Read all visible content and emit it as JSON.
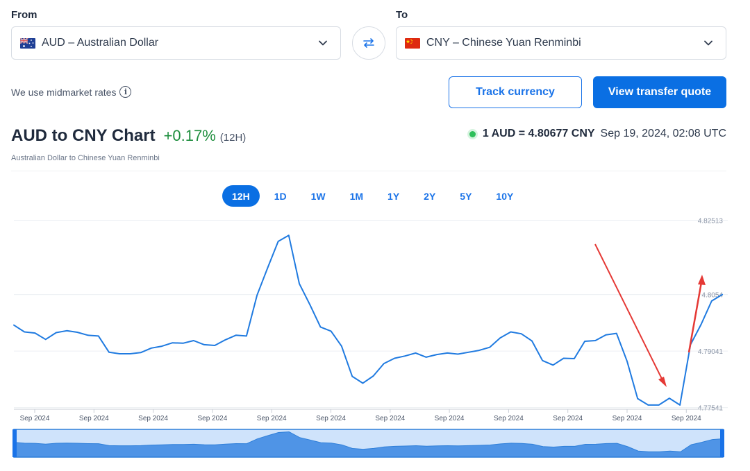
{
  "from": {
    "label": "From",
    "currency": "AUD – Australian Dollar"
  },
  "to": {
    "label": "To",
    "currency": "CNY – Chinese Yuan Renminbi"
  },
  "midmarket_text": "We use midmarket rates",
  "buttons": {
    "track": "Track currency",
    "quote": "View transfer quote"
  },
  "header": {
    "title": "AUD to CNY Chart",
    "change": "+0.17%",
    "period": "(12H)",
    "subtitle": "Australian Dollar to Chinese Yuan Renminbi"
  },
  "rate": {
    "value": "1 AUD = 4.80677 CNY",
    "timestamp": "Sep 19, 2024, 02:08 UTC"
  },
  "periods": [
    "12H",
    "1D",
    "1W",
    "1M",
    "1Y",
    "2Y",
    "5Y",
    "10Y"
  ],
  "active_period": "12H",
  "colors": {
    "accent": "#0a6fe3",
    "line": "#1f7ae0",
    "positive": "#1e8e3e",
    "annotation": "#e53935"
  },
  "chart_data": {
    "type": "line",
    "title": "AUD to CNY Chart",
    "ylim": [
      4.7735,
      4.8265
    ],
    "y_tick_values": [
      4.82513,
      4.80541,
      4.79041,
      4.77541
    ],
    "y_tick_labels": [
      "4.82513",
      "4.8054",
      "4.79041",
      "4.77541"
    ],
    "x_tick_labels": [
      "Sep 2024",
      "Sep 2024",
      "Sep 2024",
      "Sep 2024",
      "Sep 2024",
      "Sep 2024",
      "Sep 2024",
      "Sep 2024",
      "Sep 2024",
      "Sep 2024",
      "Sep 2024",
      "Sep 2024"
    ],
    "grid": true,
    "series": [
      {
        "values": [
          4.7973,
          4.7955,
          4.7952,
          4.7935,
          4.7953,
          4.7958,
          4.7954,
          4.7946,
          4.7944,
          4.7901,
          4.7897,
          4.7897,
          4.79,
          4.7912,
          4.7917,
          4.7926,
          4.7925,
          4.7932,
          4.7921,
          4.7919,
          4.7934,
          4.7946,
          4.7944,
          4.8052,
          4.8125,
          4.8195,
          4.8211,
          4.8083,
          4.8027,
          4.7968,
          4.7957,
          4.7917,
          4.7837,
          4.7819,
          4.7838,
          4.7871,
          4.7885,
          4.7891,
          4.7899,
          4.7888,
          4.7895,
          4.7899,
          4.7896,
          4.7901,
          4.7906,
          4.7914,
          4.7939,
          4.7955,
          4.795,
          4.7931,
          4.7879,
          4.7867,
          4.7885,
          4.7884,
          4.793,
          4.7932,
          4.7947,
          4.7951,
          4.7877,
          4.7778,
          4.7761,
          4.7761,
          4.7779,
          4.7761,
          4.7921,
          4.7975,
          4.8037,
          4.8054
        ]
      }
    ]
  }
}
